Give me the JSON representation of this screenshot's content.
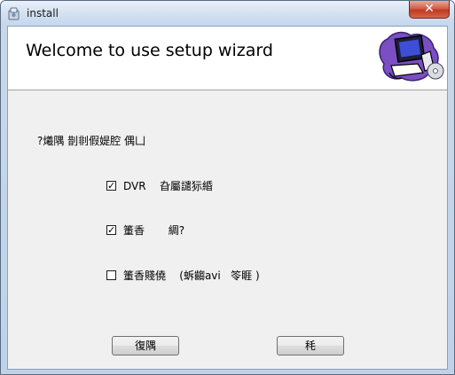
{
  "window": {
    "title": "install",
    "close_glyph": "✕"
  },
  "header": {
    "title": "Welcome to use setup wizard",
    "image": "computer-cd-icon"
  },
  "intro_text": "?爔隅  剒剕假媞腔  偶凵",
  "options": [
    {
      "label": "DVR    旮屬譴狋緍",
      "checked": true
    },
    {
      "label": "箽香       綢?",
      "checked": true
    },
    {
      "label": "箽香賤僥    (蚸齺avi   笭睚 )",
      "checked": false
    }
  ],
  "check_glyph": "✓",
  "buttons": {
    "back_label": "復隅",
    "next_label": "秏"
  }
}
